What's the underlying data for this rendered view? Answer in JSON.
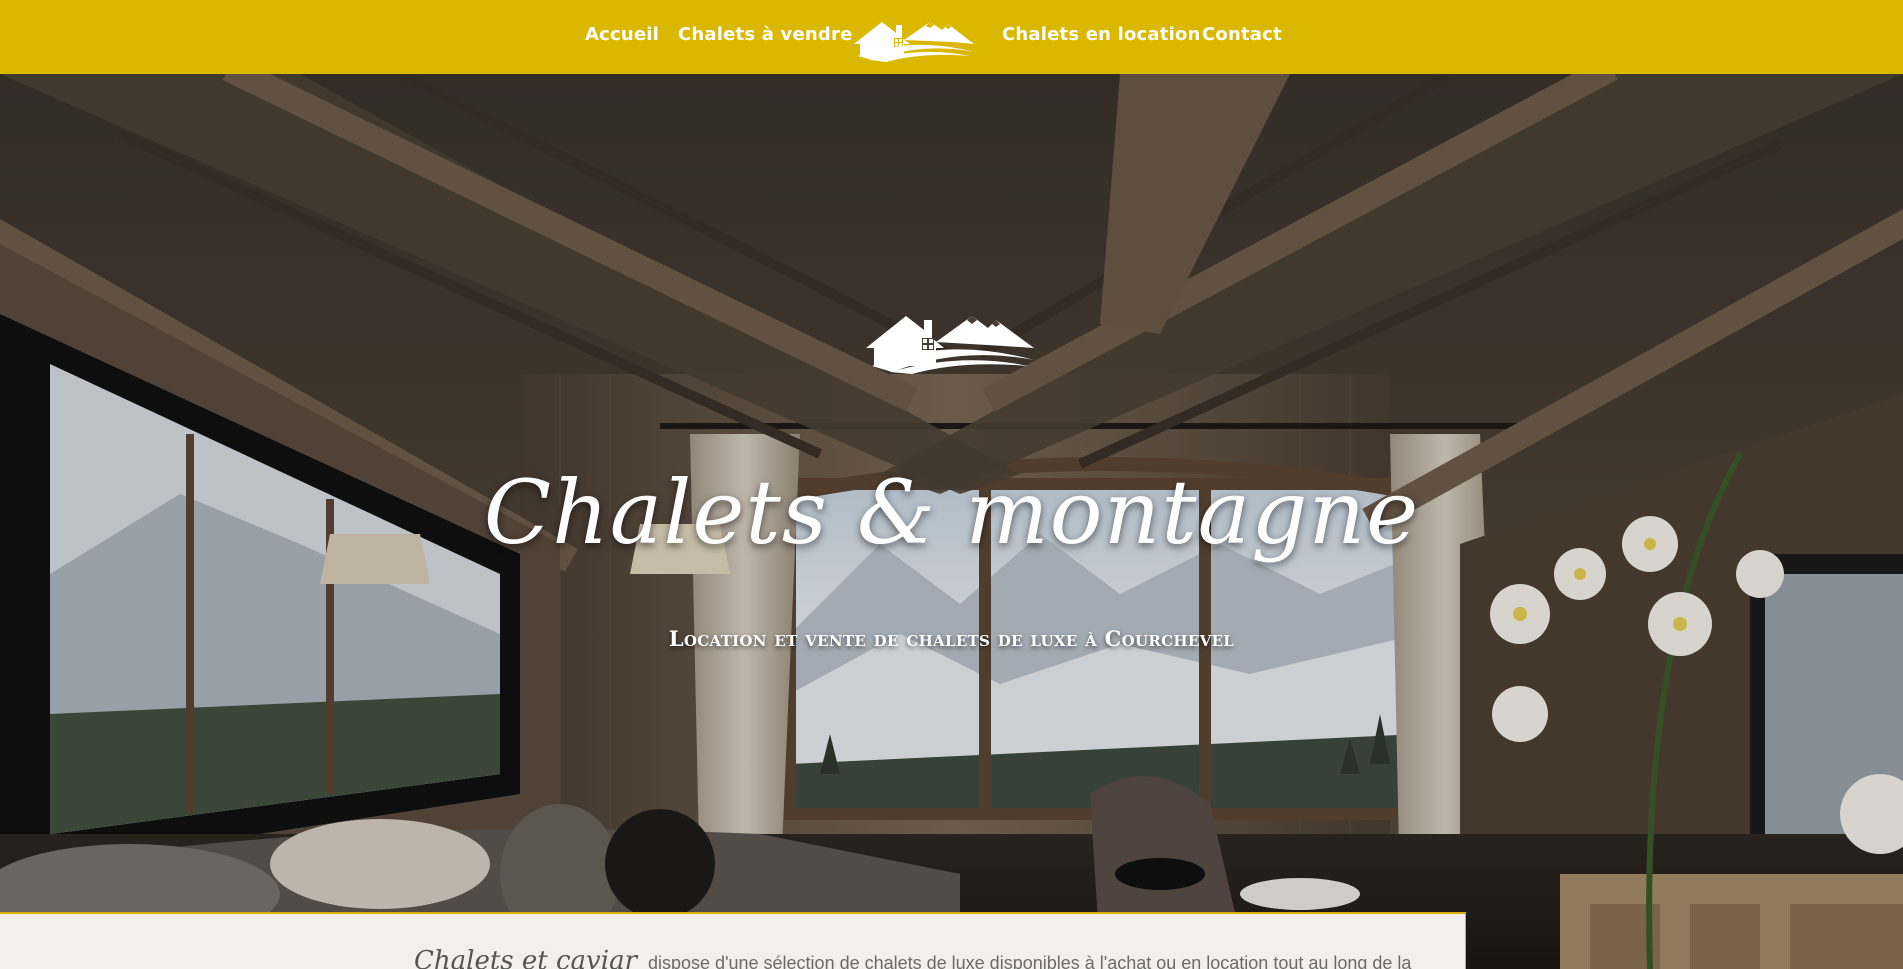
{
  "nav": {
    "items": [
      {
        "label": "Accueil"
      },
      {
        "label": "Chalets à vendre"
      },
      {
        "label": "Chalets en location"
      },
      {
        "label": "Contact"
      }
    ],
    "logo_icon": "chalet-mountain-logo-icon"
  },
  "hero": {
    "title": "Chalets & montagne",
    "subtitle": "Location et vente de chalets de luxe à Courchevel",
    "logo_icon": "chalet-mountain-logo-icon"
  },
  "intro": {
    "brand": "Chalets et caviar",
    "text": "dispose d'une sélection de chalets de luxe disponibles à l'achat ou en location tout au long de la"
  },
  "colors": {
    "nav_background": "#dbb800",
    "panel_background": "#f1f0ee",
    "text_white": "#ffffff"
  }
}
